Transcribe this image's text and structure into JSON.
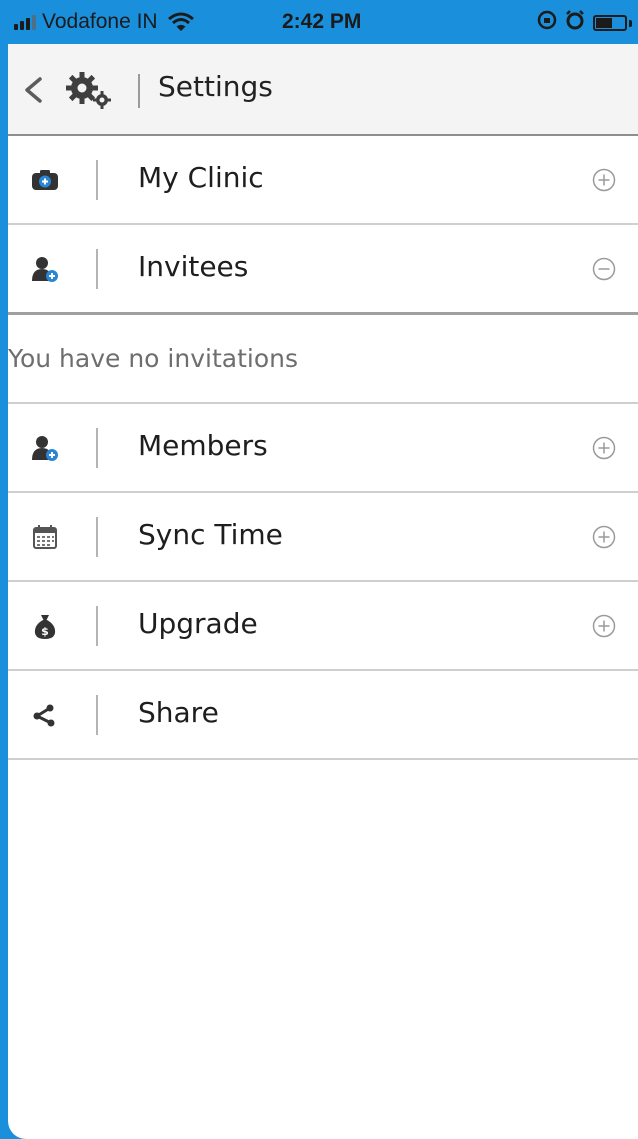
{
  "status_bar": {
    "carrier": "Vodafone IN",
    "time": "2:42 PM"
  },
  "header": {
    "title": "Settings",
    "back_icon": "chevron-left-icon",
    "app_icon": "gears-icon"
  },
  "menu": {
    "items": [
      {
        "label": "My Clinic",
        "icon": "clinic-camera-icon",
        "toggle": "plus"
      },
      {
        "label": "Invitees",
        "icon": "add-user-icon",
        "toggle": "minus"
      },
      {
        "label": "Members",
        "icon": "add-user-icon",
        "toggle": "plus"
      },
      {
        "label": "Sync Time",
        "icon": "calendar-icon",
        "toggle": "plus"
      },
      {
        "label": "Upgrade",
        "icon": "money-bag-icon",
        "toggle": "plus"
      },
      {
        "label": "Share",
        "icon": "share-icon",
        "toggle": "none"
      }
    ],
    "invitees_empty_message": "You have no invitations"
  },
  "colors": {
    "frame": "#1a8fdc",
    "header_bg": "#f4f4f4",
    "accent_icon": "#2a86d4"
  }
}
